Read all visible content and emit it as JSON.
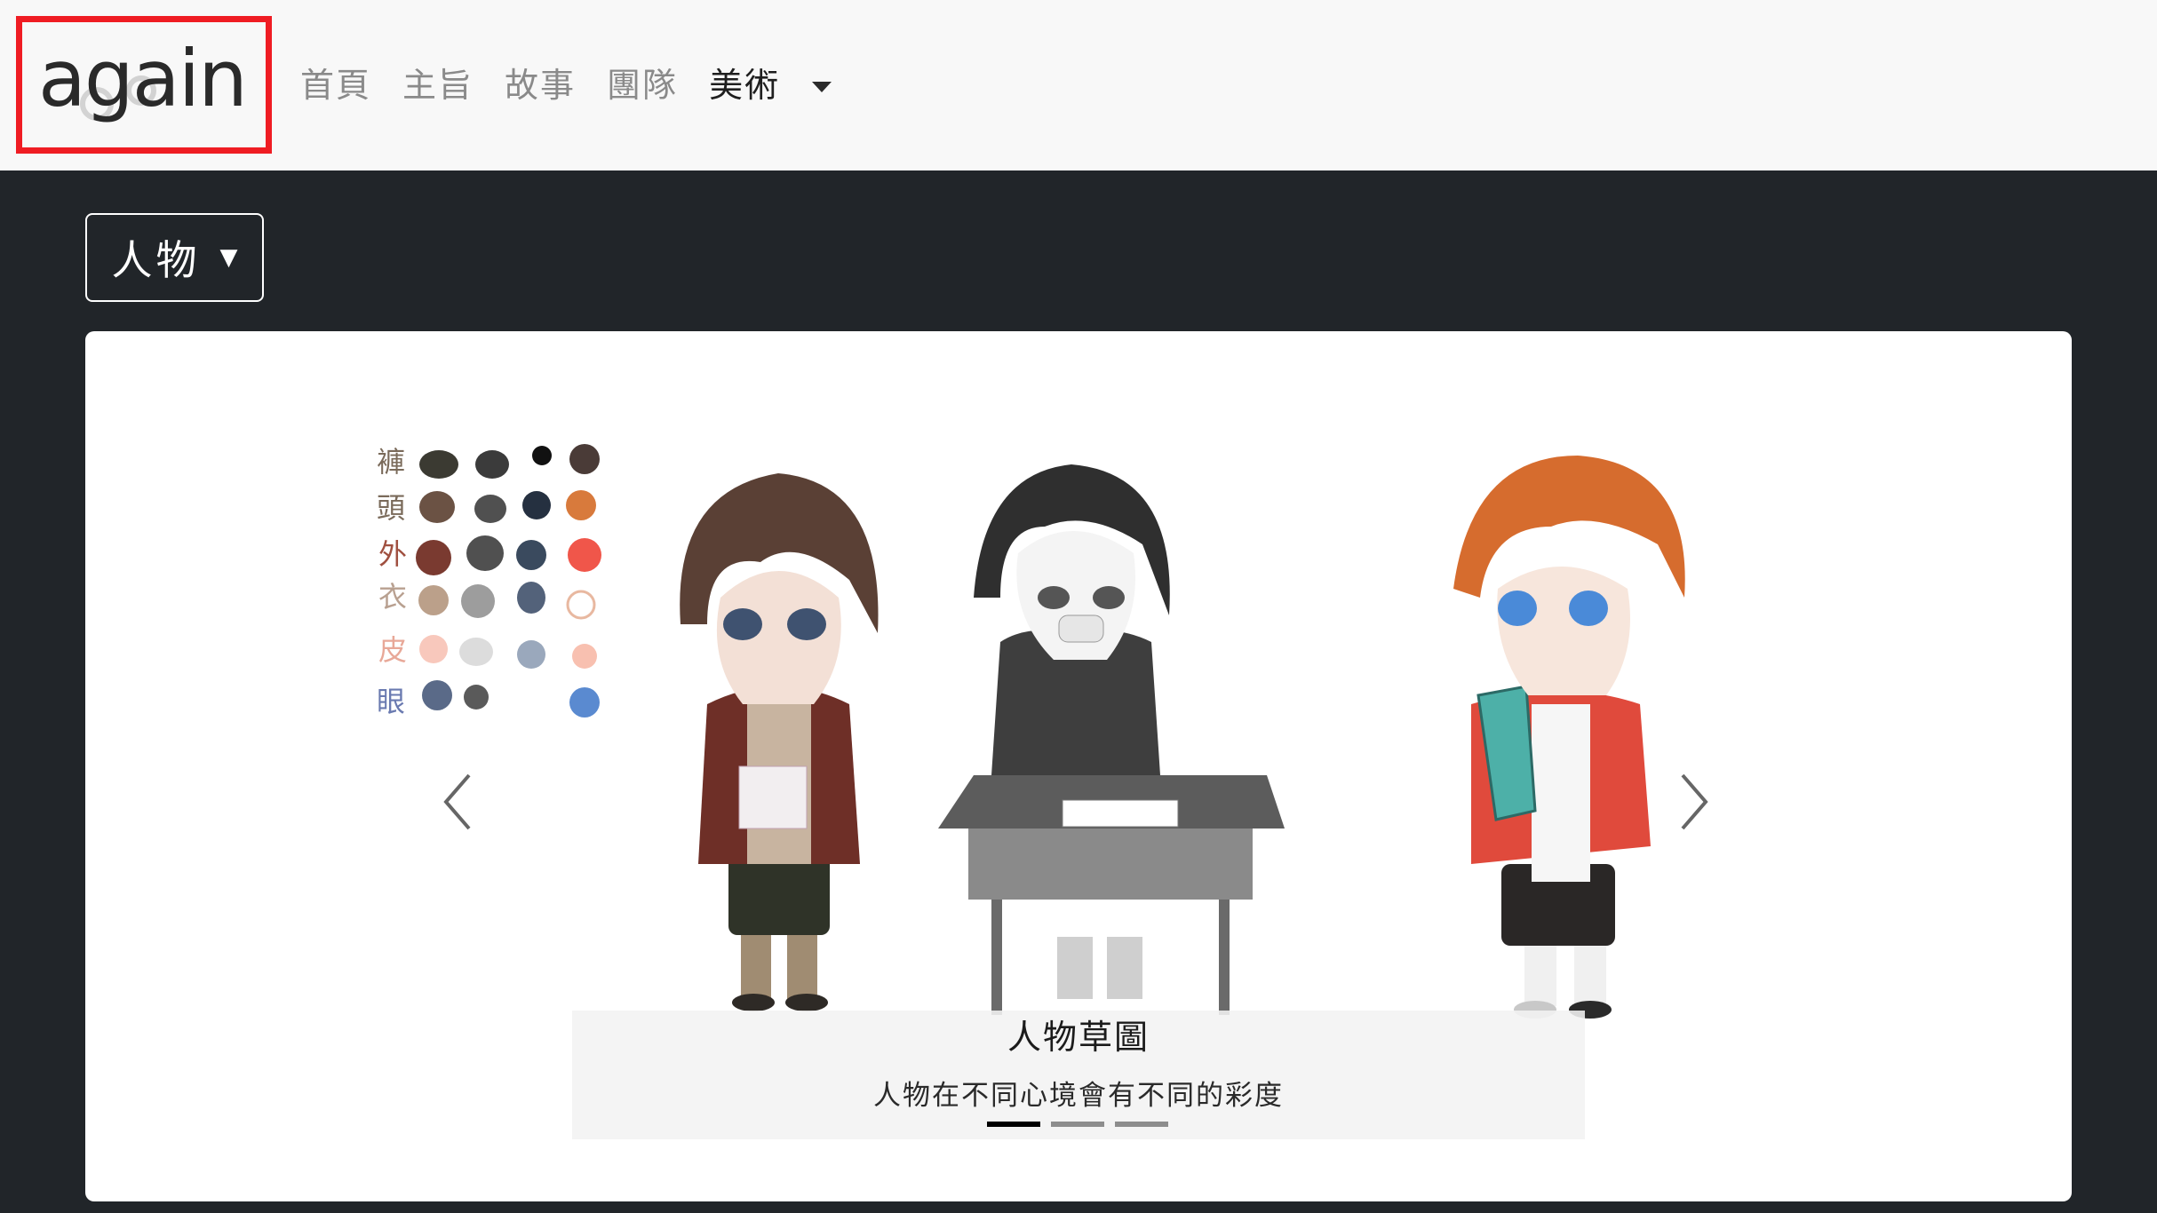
{
  "logo": {
    "text": "again"
  },
  "nav": {
    "items": [
      "首頁",
      "主旨",
      "故事",
      "團隊"
    ],
    "active": "美術"
  },
  "dropdown": {
    "label": "人物",
    "arrow": "▼"
  },
  "carousel": {
    "caption_title": "人物草圖",
    "caption_text": "人物在不同心境會有不同的彩度",
    "indicators": 3,
    "active_index": 0,
    "palette_labels": [
      "褲",
      "頭",
      "外",
      "衣",
      "皮",
      "眼"
    ]
  },
  "colors": {
    "navbar_bg": "#f8f8f8",
    "page_bg": "#212529",
    "logo_border": "#ef1c23",
    "indicator_active": "#000000",
    "indicator_inactive": "#8d8d8d"
  },
  "icons": [
    "caret-down-icon",
    "chevron-left-icon",
    "chevron-right-icon"
  ]
}
